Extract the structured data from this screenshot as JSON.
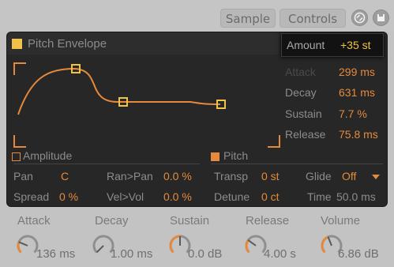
{
  "tabs": {
    "sample": "Sample",
    "controls": "Controls"
  },
  "icons": {
    "hotswap": "hotswap-icon",
    "save": "save-icon"
  },
  "colors": {
    "accent_orange": "#e58a3c",
    "accent_yellow": "#f0c248",
    "panel_bg": "#272727"
  },
  "envelope": {
    "title": "Pitch Envelope",
    "amount_label": "Amount",
    "amount_value": "+35 st",
    "attack_label": "Attack",
    "attack_value": "299 ms",
    "decay_label": "Decay",
    "decay_value": "631 ms",
    "sustain_label": "Sustain",
    "sustain_value": "7.7 %",
    "release_label": "Release",
    "release_value": "75.8 ms"
  },
  "amplitude": {
    "title": "Amplitude",
    "pan_label": "Pan",
    "pan_value": "C",
    "ranpan_label": "Ran>Pan",
    "ranpan_value": "0.0 %",
    "spread_label": "Spread",
    "spread_value": "0 %",
    "velvol_label": "Vel>Vol",
    "velvol_value": "0.0 %"
  },
  "pitch": {
    "title": "Pitch",
    "transp_label": "Transp",
    "transp_value": "0 st",
    "glide_label": "Glide",
    "glide_value": "Off",
    "detune_label": "Detune",
    "detune_value": "0 ct",
    "time_label": "Time",
    "time_value": "50.0 ms"
  },
  "knobs": [
    {
      "label": "Attack",
      "value": "136 ms",
      "level": 0.25
    },
    {
      "label": "Decay",
      "value": "1.00 ms",
      "level": 0.0
    },
    {
      "label": "Sustain",
      "value": "0.0 dB",
      "level": 0.5
    },
    {
      "label": "Release",
      "value": "4.00 s",
      "level": 0.3
    },
    {
      "label": "Volume",
      "value": "6.86 dB",
      "level": 0.42
    }
  ]
}
